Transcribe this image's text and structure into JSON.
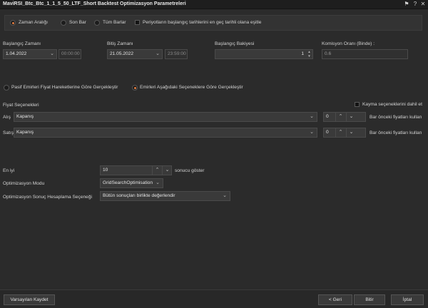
{
  "window": {
    "title": "MaviRSI_Btc_Btc_1_1_5_50_LTF_Short Backtest Optimizasyon Parametreleri"
  },
  "range_options": {
    "zaman_araligi": "Zaman Aralığı",
    "son_bar": "Son Bar",
    "tum_barlar": "Tüm Barlar",
    "selected": "Zaman Aralığı",
    "portfolio_check_label": "Periyotların başlangıç tarihlerini en geç tarihli olana eşitle"
  },
  "dates": {
    "start_label": "Başlangıç Zamanı",
    "start_date": "1.04.2022",
    "start_time": "00:00:00",
    "end_label": "Bitiş Zamanı",
    "end_date": "21.05.2022",
    "end_time": "23:59:00"
  },
  "balance": {
    "label": "Başlangıç Bakiyesi",
    "value": "1"
  },
  "commission": {
    "label": "Komisyon Oranı (Binde) :",
    "value": "0.6"
  },
  "execution": {
    "passive_label": "Pasif Emirleri Fiyat Hareketlerine Göre Gerçekleştir",
    "orders_label": "Emirleri Aşağıdaki Seçeneklere Göre Gerçekleştir",
    "selected": "orders"
  },
  "price_options": {
    "section_label": "Fiyat Seçenekleri",
    "slippage_label": "Kayma seçeneklerini dahil et",
    "buy": {
      "label": "Alış",
      "source": "Kapanış",
      "bars": "0",
      "suffix": "Bar önceki fiyatları kullan"
    },
    "sell": {
      "label": "Satış :",
      "source": "Kapanış",
      "bars": "0",
      "suffix": "Bar önceki fiyatları kullan"
    }
  },
  "optimization": {
    "best_label": "En iyi",
    "best_value": "10",
    "best_suffix": "sonucu göster",
    "mode_label": "Optimizasyon Modu",
    "mode_value": "GridSearchOptimisation",
    "calc_label": "Optimizasyon Sonuç Hesaplama Seçeneği",
    "calc_value": "Bütün sonuçları birlikte değerlendir"
  },
  "footer": {
    "save_defaults": "Varsayılan Kaydet",
    "back": "< Geri",
    "finish": "Bitir",
    "cancel": "İptal"
  },
  "colors": {
    "accent": "#e07b3f",
    "background": "#2b2b2b",
    "field": "#3a3a3a"
  }
}
